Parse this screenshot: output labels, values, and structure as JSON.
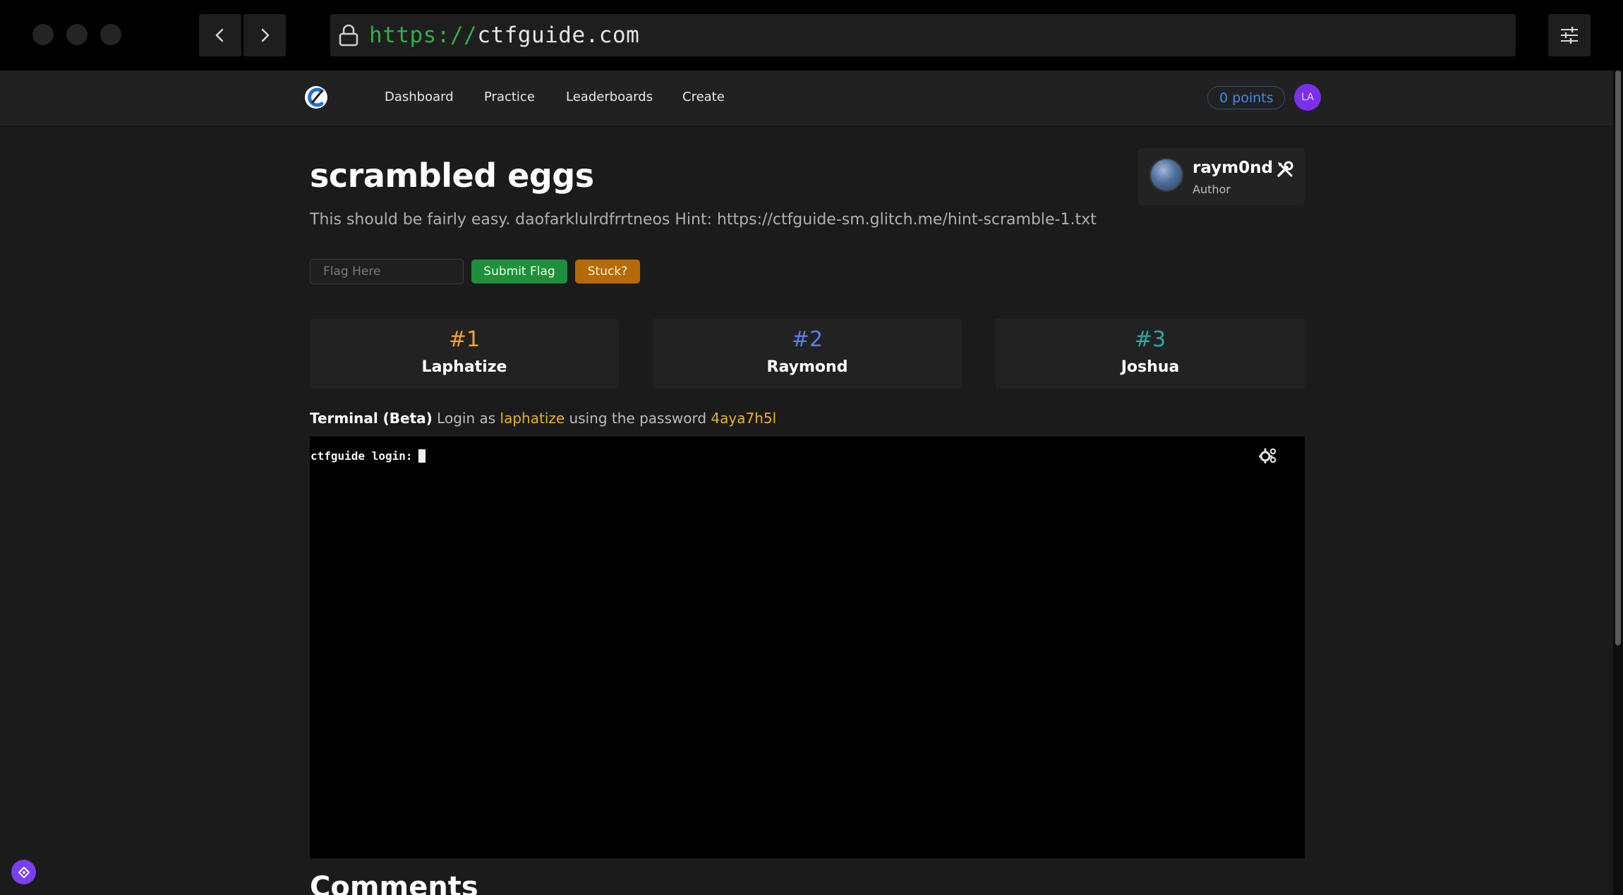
{
  "browser": {
    "url_scheme": "https://",
    "url_host": "ctfguide.com"
  },
  "nav": {
    "links": [
      "Dashboard",
      "Practice",
      "Leaderboards",
      "Create"
    ],
    "points": "0 points",
    "user_initials": "LA"
  },
  "challenge": {
    "title": "scrambled eggs",
    "description": "This should be fairly easy. daofarklulrdfrrtneos Hint: https://ctfguide-sm.glitch.me/hint-scramble-1.txt",
    "author_name": "raym0nd",
    "author_role": "Author",
    "flag_placeholder": "Flag Here",
    "submit_label": "Submit Flag",
    "stuck_label": "Stuck?"
  },
  "leaderboard": [
    {
      "rank": "#1",
      "name": "Laphatize",
      "color": "#f0a531"
    },
    {
      "rank": "#2",
      "name": "Raymond",
      "color": "#5b7fe6"
    },
    {
      "rank": "#3",
      "name": "Joshua",
      "color": "#2fa8a0"
    }
  ],
  "terminal": {
    "label_title": "Terminal (Beta)",
    "label_pre": "Login as",
    "username": "laphatize",
    "label_mid": "using the password",
    "password": "4aya7h5l",
    "prompt": "ctfguide login:"
  },
  "comments_heading": "Comments",
  "colors": {
    "accent_highlight": "#e7b41c",
    "submit_green": "#1f8f3c",
    "stuck_orange": "#b56a06",
    "points_blue": "#3b8df0",
    "avatar_purple": "#7b2ff0"
  },
  "icons": [
    "lock-icon",
    "back-icon",
    "forward-icon",
    "sliders-icon",
    "tools-icon",
    "gears-icon",
    "logo-icon"
  ]
}
